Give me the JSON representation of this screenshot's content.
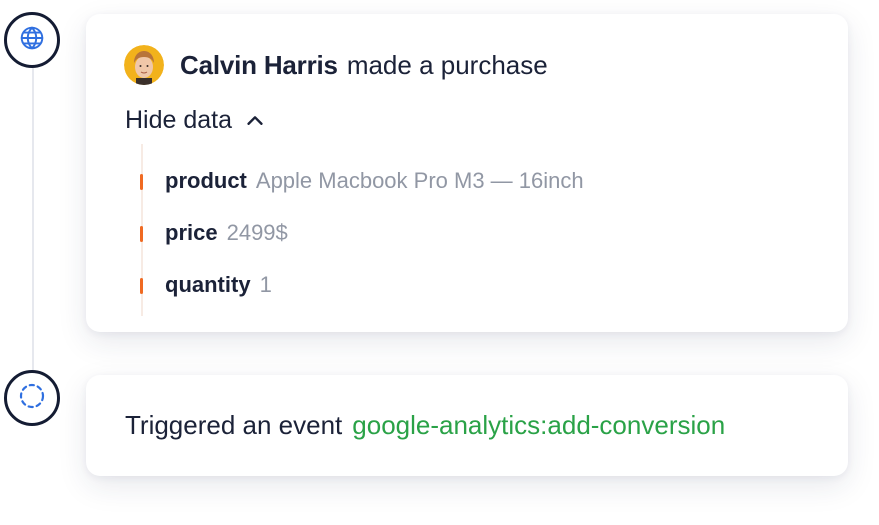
{
  "timeline": {
    "nodes": [
      {
        "icon": "globe-icon",
        "color": "#2f6fe0"
      },
      {
        "icon": "dashed-circle-icon",
        "color": "#2f6fe0"
      }
    ]
  },
  "purchase_card": {
    "user_name": "Calvin Harris",
    "action": "made a purchase",
    "toggle_label": "Hide data",
    "toggle_icon": "chevron-up-icon",
    "data_items": [
      {
        "key": "product",
        "value": "Apple Macbook Pro M3 — 16inch"
      },
      {
        "key": "price",
        "value": "2499$"
      },
      {
        "key": "quantity",
        "value": "1"
      }
    ],
    "marker_color": "#f06a22"
  },
  "event_card": {
    "text": "Triggered an event",
    "event_name": "google-analytics:add-conversion",
    "event_color": "#2aa247"
  }
}
